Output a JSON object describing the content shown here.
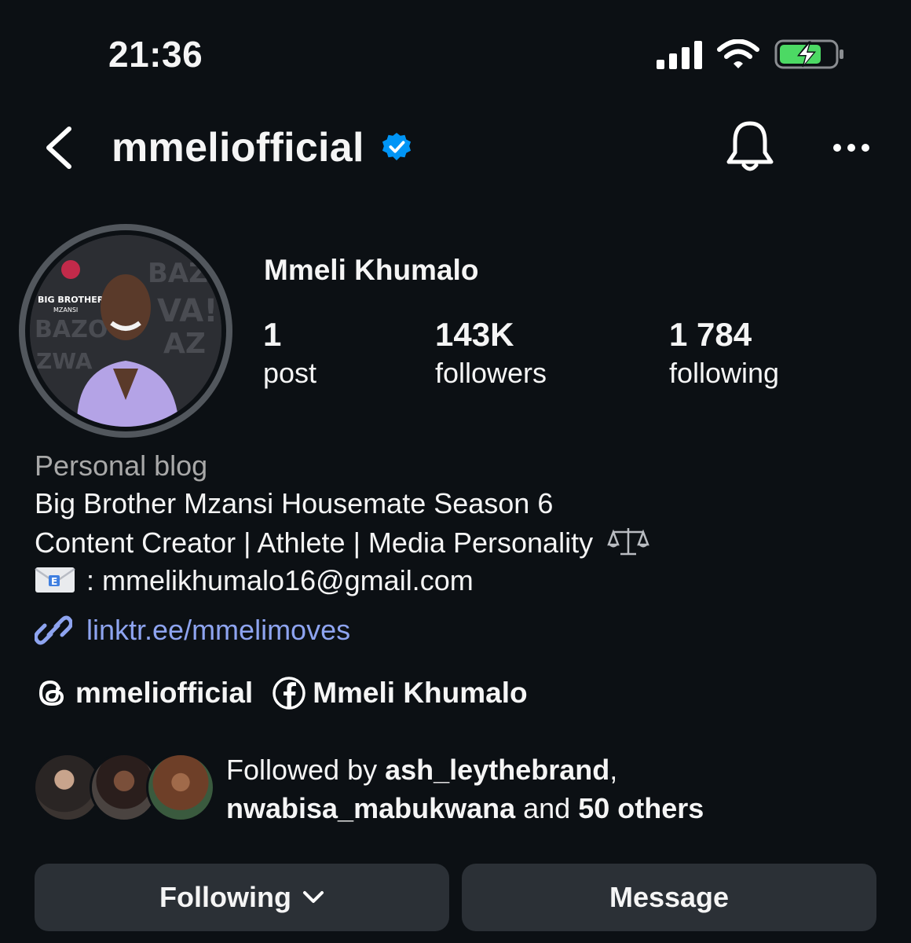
{
  "status_bar": {
    "time": "21:36",
    "icons": [
      "signal-icon",
      "wifi-icon",
      "battery-charging-icon"
    ]
  },
  "header": {
    "username": "mmeliofficial",
    "verified": true,
    "icons": [
      "back-chevron-icon",
      "verified-badge-icon",
      "bell-icon",
      "more-icon"
    ]
  },
  "profile": {
    "display_name": "Mmeli Khumalo",
    "stats": {
      "posts": {
        "value": "1",
        "label": "post"
      },
      "followers": {
        "value": "143K",
        "label": "followers"
      },
      "following": {
        "value": "1 784",
        "label": "following"
      }
    },
    "category": "Personal blog",
    "bio": {
      "line1": "Big Brother Mzansi Housemate Season 6",
      "line2": "Content Creator | Athlete | Media Personality",
      "line3": ": mmelikhumalo16@gmail.com"
    },
    "link": "linktr.ee/mmelimoves",
    "socials": {
      "threads": "mmeliofficial",
      "facebook": "Mmeli Khumalo"
    },
    "followed_by": {
      "prefix": "Followed by ",
      "user1": "ash_leythebrand",
      "sep": ",",
      "user2": "nwabisa_mabukwana",
      "and": " and ",
      "others": "50 others"
    }
  },
  "actions": {
    "following": "Following",
    "message": "Message"
  },
  "colors": {
    "background": "#0c1014",
    "button": "#2b3036",
    "link": "#8ea4f0",
    "verified": "#0095f6",
    "battery_fill": "#4cd964"
  }
}
